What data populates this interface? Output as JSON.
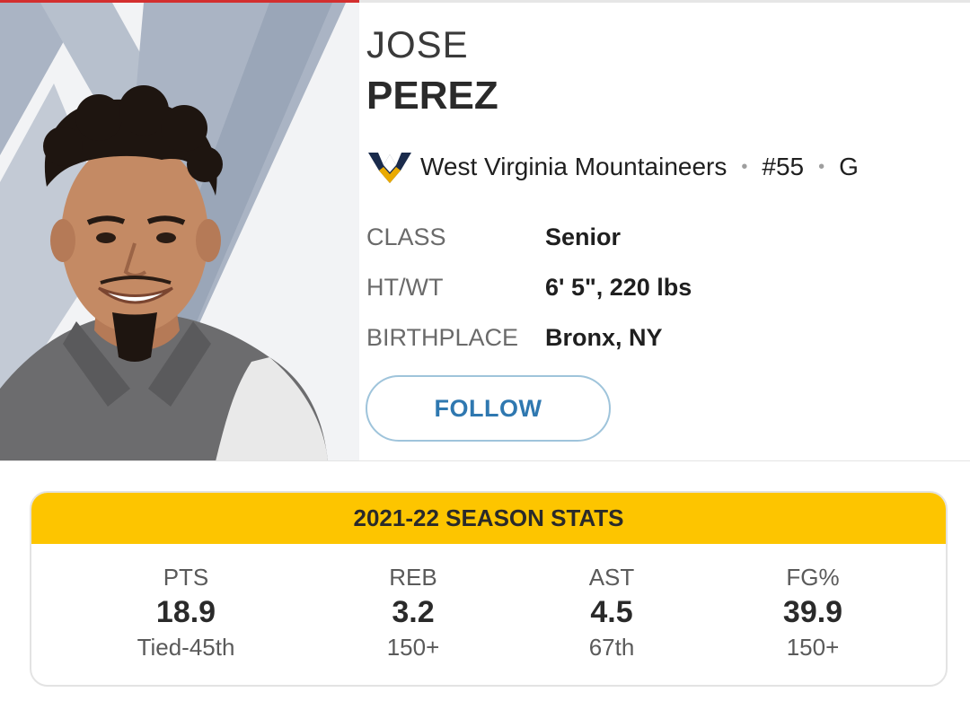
{
  "player": {
    "first_name": "JOSE",
    "last_name": "PEREZ",
    "team": "West Virginia Mountaineers",
    "team_logo_icon": "wv-flying-wv-logo-icon",
    "number": "#55",
    "position": "G",
    "separator": "•"
  },
  "info": [
    {
      "label": "CLASS",
      "value": "Senior"
    },
    {
      "label": "HT/WT",
      "value": "6' 5\", 220 lbs"
    },
    {
      "label": "BIRTHPLACE",
      "value": "Bronx, NY"
    }
  ],
  "follow_label": "FOLLOW",
  "stats": {
    "title": "2021-22 SEASON STATS",
    "items": [
      {
        "label": "PTS",
        "value": "18.9",
        "rank": "Tied-45th"
      },
      {
        "label": "REB",
        "value": "3.2",
        "rank": "150+"
      },
      {
        "label": "AST",
        "value": "4.5",
        "rank": "67th"
      },
      {
        "label": "FG%",
        "value": "39.9",
        "rank": "150+"
      }
    ]
  },
  "colors": {
    "accent_red": "#d32f2f",
    "stats_header_yellow": "#fdc500",
    "follow_blue": "#2f78b0",
    "team_navy": "#1a2b4c",
    "team_gold": "#eaaa00"
  }
}
